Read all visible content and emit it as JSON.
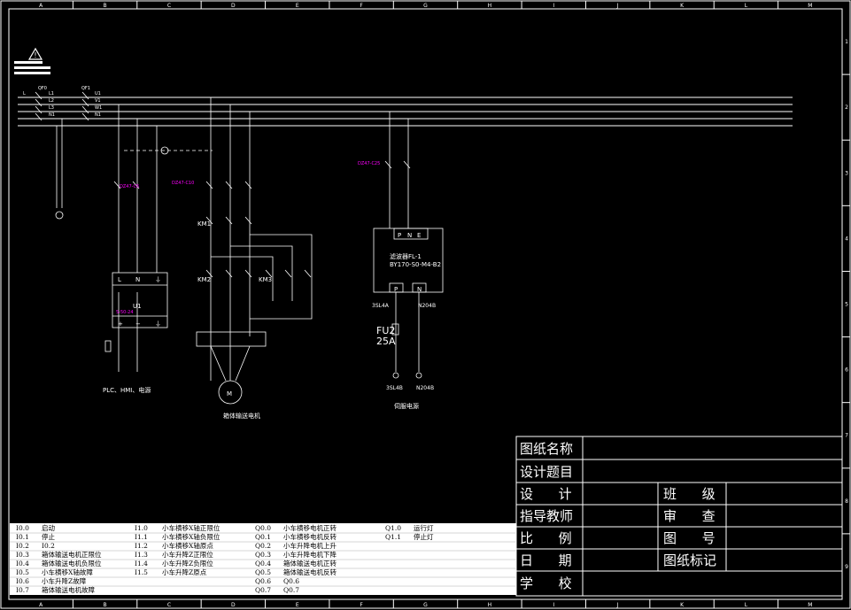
{
  "frame": {
    "columns": [
      "A",
      "B",
      "C",
      "D",
      "E",
      "F",
      "G",
      "H",
      "I",
      "J",
      "K",
      "L",
      "M"
    ],
    "rows": [
      "1",
      "2",
      "3",
      "4",
      "5",
      "6",
      "7",
      "8",
      "9"
    ]
  },
  "schematic": {
    "main_breaker": "QF1",
    "left_switch": "QF0",
    "phase_labels": [
      "L1",
      "L2",
      "L3",
      "N1"
    ],
    "phase_outputs": [
      "U1",
      "V1",
      "W1",
      "N1"
    ],
    "power_left_label": "PLC、HMI、电源",
    "psu_label": "U1",
    "psu_terminals_top": [
      "L",
      "N",
      "⏚"
    ],
    "psu_terminals_bottom": [
      "+",
      "−",
      "⏚"
    ],
    "motor_symbol": "M",
    "motor_label": "箱体输送电机",
    "km1": "KM1",
    "km2": "KM2",
    "km3": "KM3",
    "filter_terminals_top": [
      "P",
      "N",
      "E"
    ],
    "filter_name": "滤波器FL-1",
    "filter_model": "BY170-S0-M4-B2",
    "filter_terminals_bottom": [
      "P",
      "N"
    ],
    "filter_out_left": "3SL4A",
    "filter_out_right": "N204B",
    "fuse_name": "FU2",
    "fuse_rating": "25A",
    "servo_term_left": "3SL4B",
    "servo_term_right": "N204B",
    "servo_label": "伺服电源",
    "colors": {
      "magenta": "#ff00ff",
      "line": "#ffffff",
      "frame": "#ffffff"
    }
  },
  "io_table": {
    "inputs_a": [
      {
        "addr": "I0.0",
        "desc": "启动"
      },
      {
        "addr": "I0.1",
        "desc": "停止"
      },
      {
        "addr": "I0.2",
        "desc": "I0.2"
      },
      {
        "addr": "I0.3",
        "desc": "箱体输送电机正限位"
      },
      {
        "addr": "I0.4",
        "desc": "箱体输送电机负限位"
      },
      {
        "addr": "I0.5",
        "desc": "小车横移X轴故障"
      },
      {
        "addr": "I0.6",
        "desc": "小车升降Z故障"
      },
      {
        "addr": "I0.7",
        "desc": "箱体输送电机故障"
      }
    ],
    "inputs_b": [
      {
        "addr": "I1.0",
        "desc": "小车横移X轴正限位"
      },
      {
        "addr": "I1.1",
        "desc": "小车横移X轴负限位"
      },
      {
        "addr": "I1.2",
        "desc": "小车横移X轴原点"
      },
      {
        "addr": "I1.3",
        "desc": "小车升降Z正限位"
      },
      {
        "addr": "I1.4",
        "desc": "小车升降Z负限位"
      },
      {
        "addr": "I1.5",
        "desc": "小车升降Z原点"
      }
    ],
    "outputs_a": [
      {
        "addr": "Q0.0",
        "desc": "小车横移电机正转"
      },
      {
        "addr": "Q0.1",
        "desc": "小车横移电机反转"
      },
      {
        "addr": "Q0.2",
        "desc": "小车升降电机上升"
      },
      {
        "addr": "Q0.3",
        "desc": "小车升降电机下降"
      },
      {
        "addr": "Q0.4",
        "desc": "箱体输送电机正转"
      },
      {
        "addr": "Q0.5",
        "desc": "箱体输送电机反转"
      },
      {
        "addr": "Q0.6",
        "desc": "Q0.6"
      },
      {
        "addr": "Q0.7",
        "desc": "Q0.7"
      }
    ],
    "outputs_b": [
      {
        "addr": "Q1.0",
        "desc": "运行灯"
      },
      {
        "addr": "Q1.1",
        "desc": "停止灯"
      }
    ]
  },
  "title_block": {
    "drawing_name": "图纸名称",
    "design_topic": "设计题目",
    "design": "设      计",
    "advisor": "指导教师",
    "scale": "比      例",
    "date": "日      期",
    "school": "学      校",
    "class": "班      级",
    "review": "审      查",
    "drawing_no": "图      号",
    "drawing_mark": "图纸标记"
  }
}
